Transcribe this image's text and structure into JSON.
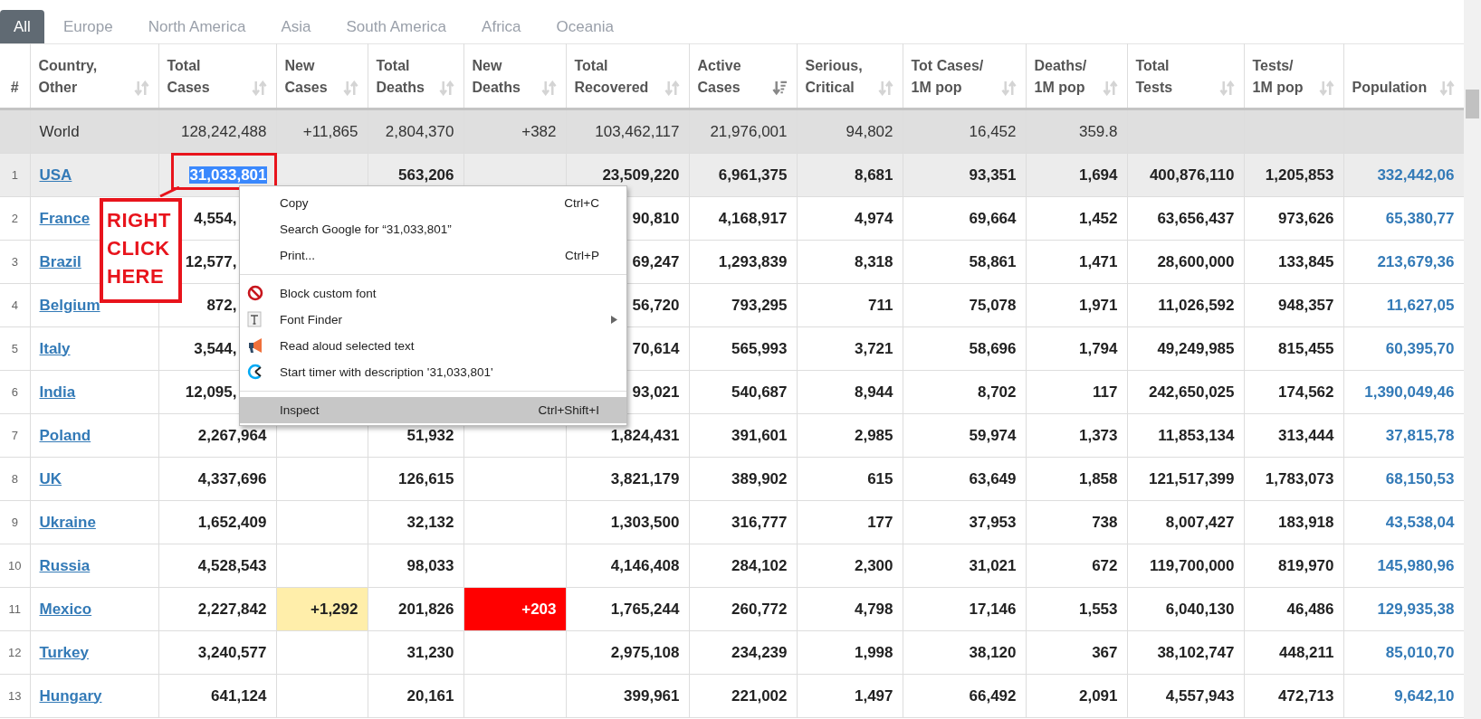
{
  "tabs": [
    {
      "label": "All",
      "selected": true
    },
    {
      "label": "Europe",
      "selected": false
    },
    {
      "label": "North America",
      "selected": false
    },
    {
      "label": "Asia",
      "selected": false
    },
    {
      "label": "South America",
      "selected": false
    },
    {
      "label": "Africa",
      "selected": false
    },
    {
      "label": "Oceania",
      "selected": false
    }
  ],
  "table": {
    "columns": [
      {
        "label": "#",
        "kind": "rank"
      },
      {
        "label": "Country,\nOther",
        "kind": "name",
        "sorted": false
      },
      {
        "label": "Total\nCases",
        "kind": "number",
        "sorted": false
      },
      {
        "label": "New\nCases",
        "kind": "increase",
        "sorted": false
      },
      {
        "label": "Total\nDeaths",
        "kind": "number",
        "sorted": false
      },
      {
        "label": "New\nDeaths",
        "kind": "death_increase",
        "sorted": false
      },
      {
        "label": "Total\nRecovered",
        "kind": "number",
        "sorted": false
      },
      {
        "label": "Active\nCases",
        "kind": "number",
        "sorted": true
      },
      {
        "label": "Serious,\nCritical",
        "kind": "number",
        "sorted": false
      },
      {
        "label": "Tot Cases/\n1M pop",
        "kind": "number",
        "sorted": false
      },
      {
        "label": "Deaths/\n1M pop",
        "kind": "number",
        "sorted": false
      },
      {
        "label": "Total\nTests",
        "kind": "number",
        "sorted": false
      },
      {
        "label": "Tests/\n1M pop",
        "kind": "number",
        "sorted": false
      },
      {
        "label": "Population",
        "kind": "link_number",
        "sorted": false
      }
    ],
    "rows": [
      {
        "kind": "total",
        "cells": [
          null,
          "World",
          "128,242,488",
          "+11,865",
          "2,804,370",
          "+382",
          "103,462,117",
          "21,976,001",
          "94,802",
          "16,452",
          "359.8",
          null,
          null,
          null
        ]
      },
      {
        "kind": "country",
        "selected": true,
        "cells": [
          "1",
          "USA",
          {
            "text": "31,033,801",
            "selected": true
          },
          null,
          "563,206",
          null,
          "23,509,220",
          "6,961,375",
          "8,681",
          "93,351",
          "1,694",
          "400,876,110",
          "1,205,853",
          "332,442,06"
        ]
      },
      {
        "kind": "country",
        "selected": false,
        "cells": [
          "2",
          "France",
          {
            "text": "4,554,",
            "clipped": true
          },
          null,
          null,
          null,
          "90,810",
          "4,168,917",
          "4,974",
          "69,664",
          "1,452",
          "63,656,437",
          "973,626",
          "65,380,77"
        ]
      },
      {
        "kind": "country",
        "selected": false,
        "cells": [
          "3",
          "Brazil",
          {
            "text": "12,577,",
            "clipped": true
          },
          null,
          null,
          null,
          "69,247",
          "1,293,839",
          "8,318",
          "58,861",
          "1,471",
          "28,600,000",
          "133,845",
          "213,679,36"
        ]
      },
      {
        "kind": "country",
        "selected": false,
        "cells": [
          "4",
          "Belgium",
          {
            "text": "872,",
            "clipped": true
          },
          null,
          null,
          null,
          "56,720",
          "793,295",
          "711",
          "75,078",
          "1,971",
          "11,026,592",
          "948,357",
          "11,627,05"
        ]
      },
      {
        "kind": "country",
        "selected": false,
        "cells": [
          "5",
          "Italy",
          {
            "text": "3,544,",
            "clipped": true
          },
          null,
          null,
          null,
          "70,614",
          "565,993",
          "3,721",
          "58,696",
          "1,794",
          "49,249,985",
          "815,455",
          "60,395,70"
        ]
      },
      {
        "kind": "country",
        "selected": false,
        "cells": [
          "6",
          "India",
          {
            "text": "12,095,",
            "clipped": true
          },
          null,
          null,
          null,
          "93,021",
          "540,687",
          "8,944",
          "8,702",
          "117",
          "242,650,025",
          "174,562",
          "1,390,049,46"
        ]
      },
      {
        "kind": "country",
        "selected": false,
        "cells": [
          "7",
          "Poland",
          "2,267,964",
          null,
          "51,932",
          null,
          "1,824,431",
          "391,601",
          "2,985",
          "59,974",
          "1,373",
          "11,853,134",
          "313,444",
          "37,815,78"
        ]
      },
      {
        "kind": "country",
        "selected": false,
        "cells": [
          "8",
          "UK",
          "4,337,696",
          null,
          "126,615",
          null,
          "3,821,179",
          "389,902",
          "615",
          "63,649",
          "1,858",
          "121,517,399",
          "1,783,073",
          "68,150,53"
        ]
      },
      {
        "kind": "country",
        "selected": false,
        "cells": [
          "9",
          "Ukraine",
          "1,652,409",
          null,
          "32,132",
          null,
          "1,303,500",
          "316,777",
          "177",
          "37,953",
          "738",
          "8,007,427",
          "183,918",
          "43,538,04"
        ]
      },
      {
        "kind": "country",
        "selected": false,
        "cells": [
          "10",
          "Russia",
          "4,528,543",
          null,
          "98,033",
          null,
          "4,146,408",
          "284,102",
          "2,300",
          "31,021",
          "672",
          "119,700,000",
          "819,970",
          "145,980,96"
        ]
      },
      {
        "kind": "country",
        "selected": false,
        "cells": [
          "11",
          "Mexico",
          "2,227,842",
          "+1,292",
          "201,826",
          "+203",
          "1,765,244",
          "260,772",
          "4,798",
          "17,146",
          "1,553",
          "6,040,130",
          "46,486",
          "129,935,38"
        ]
      },
      {
        "kind": "country",
        "selected": false,
        "cells": [
          "12",
          "Turkey",
          "3,240,577",
          null,
          "31,230",
          null,
          "2,975,108",
          "234,239",
          "1,998",
          "38,120",
          "367",
          "38,102,747",
          "448,211",
          "85,010,70"
        ]
      },
      {
        "kind": "country",
        "selected": false,
        "cells": [
          "13",
          "Hungary",
          "641,124",
          null,
          "20,161",
          null,
          "399,961",
          "221,002",
          "1,497",
          "66,492",
          "2,091",
          "4,557,943",
          "472,713",
          "9,642,10"
        ]
      }
    ]
  },
  "annotation": {
    "text": "RIGHT CLICK HERE"
  },
  "context_menu": {
    "items": [
      {
        "kind": "item",
        "label": "Copy",
        "shortcut": "Ctrl+C",
        "selected": false
      },
      {
        "kind": "item",
        "label": "Search Google for “31,033,801”",
        "selected": false
      },
      {
        "kind": "item",
        "label": "Print...",
        "shortcut": "Ctrl+P",
        "selected": false
      },
      {
        "kind": "separator"
      },
      {
        "kind": "item",
        "label": "Block custom font",
        "selected": false
      },
      {
        "kind": "item",
        "label": "Font Finder",
        "submenu": true,
        "selected": false
      },
      {
        "kind": "item",
        "label": "Read aloud selected text",
        "selected": false
      },
      {
        "kind": "item",
        "label": "Start timer with description '31,033,801'",
        "selected": false
      },
      {
        "kind": "separator"
      },
      {
        "kind": "item",
        "label": "Inspect",
        "shortcut": "Ctrl+Shift+I",
        "selected": true
      }
    ]
  }
}
